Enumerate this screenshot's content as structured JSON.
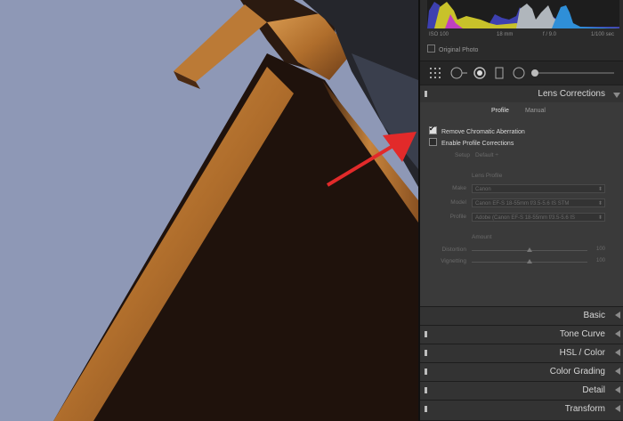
{
  "histogram": {
    "iso": "ISO 100",
    "focal": "18 mm",
    "aperture": "f / 9.0",
    "shutter": "1/100 sec",
    "original_photo_label": "Original Photo"
  },
  "lens_corrections": {
    "title": "Lens Corrections",
    "tabs": {
      "profile": "Profile",
      "manual": "Manual"
    },
    "remove_ca_label": "Remove Chromatic Aberration",
    "remove_ca_checked": true,
    "enable_profile_label": "Enable Profile Corrections",
    "enable_profile_checked": false,
    "setup_label": "Setup",
    "setup_value": "Default ÷",
    "lens_profile_heading": "Lens Profile",
    "make_label": "Make",
    "make_value": "Canon",
    "model_label": "Model",
    "model_value": "Canon EF-S 18-55mm f/3.5-5.6 IS STM",
    "profile_label": "Profile",
    "profile_value": "Adobe (Canon EF-S 18-55mm f/3.5-5.6 IS",
    "amount_heading": "Amount",
    "distortion_label": "Distortion",
    "distortion_value": "100",
    "vignetting_label": "Vignetting",
    "vignetting_value": "100"
  },
  "panels": [
    {
      "title": "Basic"
    },
    {
      "title": "Tone Curve"
    },
    {
      "title": "HSL / Color"
    },
    {
      "title": "Color Grading"
    },
    {
      "title": "Detail"
    },
    {
      "title": "Transform"
    }
  ],
  "colors": {
    "sky": "#8e98b6",
    "roof_wood": "#c4843c",
    "roof_dark": "#1f120c",
    "arrow": "#e22a2a"
  }
}
